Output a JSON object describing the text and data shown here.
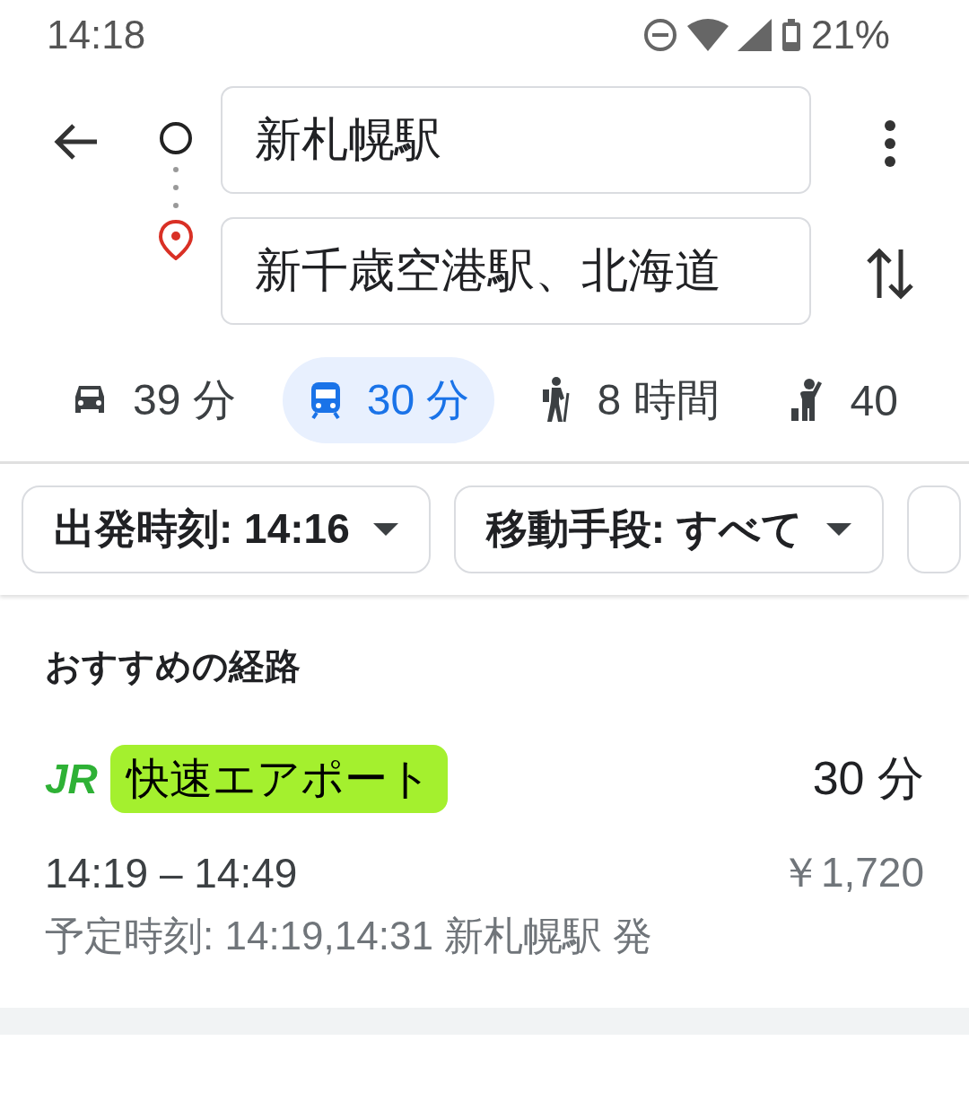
{
  "status_bar": {
    "time": "14:18",
    "battery": "21%"
  },
  "search": {
    "origin": "新札幌駅",
    "destination": "新千歳空港駅、北海道"
  },
  "modes": [
    {
      "kind": "car",
      "label": "39 分",
      "selected": false
    },
    {
      "kind": "train",
      "label": "30 分",
      "selected": true
    },
    {
      "kind": "walk",
      "label": "8 時間",
      "selected": false
    },
    {
      "kind": "ride",
      "label": "40",
      "selected": false
    }
  ],
  "filters": [
    {
      "label": "出発時刻: 14:16"
    },
    {
      "label": "移動手段: すべて"
    }
  ],
  "section_title": "おすすめの経路",
  "route": {
    "operator": "JR",
    "line": "快速エアポート",
    "color": "#a4f02e",
    "duration": "30 分",
    "times": "14:19 – 14:49",
    "fare": "￥1,720",
    "schedule": "予定時刻: 14:19,14:31 新札幌駅 発"
  }
}
